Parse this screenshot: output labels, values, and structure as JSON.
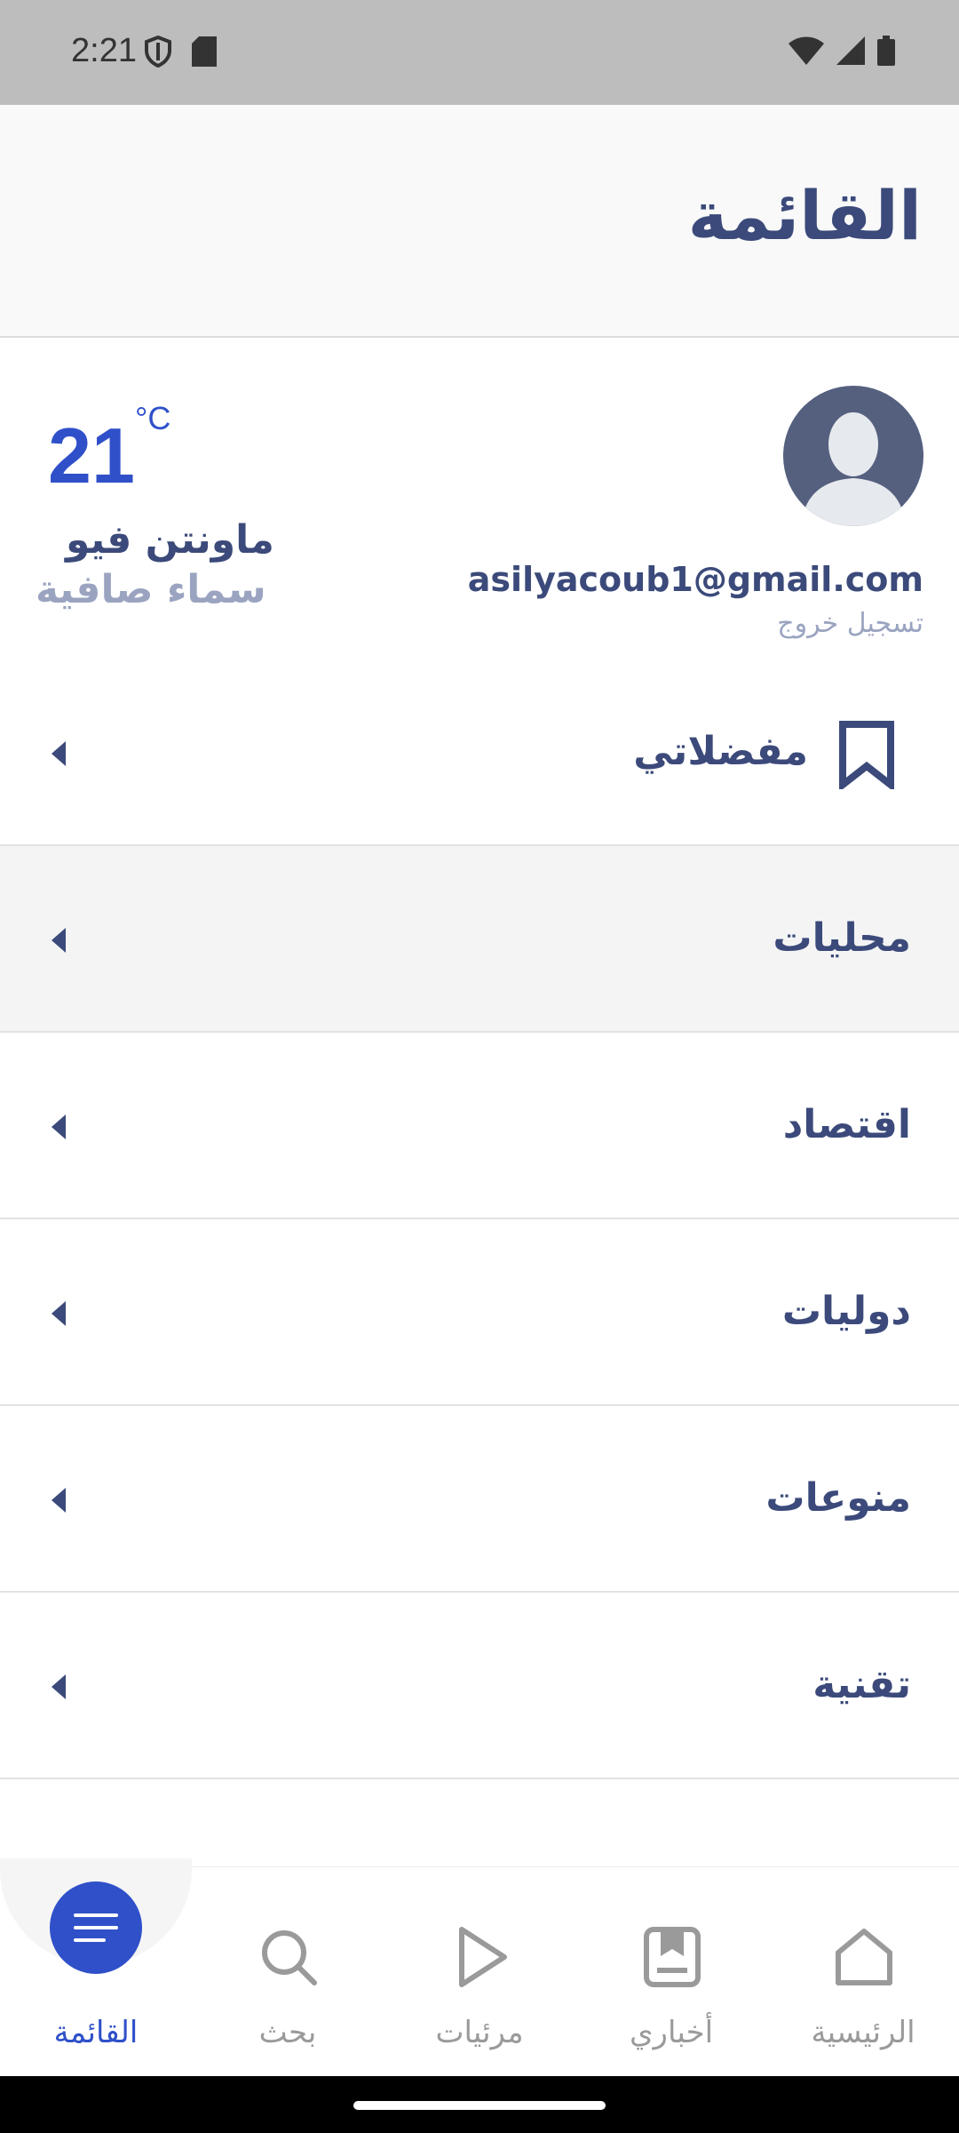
{
  "status_bar": {
    "time": "2:21"
  },
  "header": {
    "title": "القائمة"
  },
  "profile": {
    "email": "asilyacoub1@gmail.com",
    "logout_label": "تسجيل خروج"
  },
  "weather": {
    "temperature": "21",
    "unit": "°C",
    "location": "ماونتن فيو",
    "condition": "سماء صافية"
  },
  "menu": {
    "items": [
      {
        "label": "مفضلاتي"
      },
      {
        "label": "محليات"
      },
      {
        "label": "اقتصاد"
      },
      {
        "label": "دوليات"
      },
      {
        "label": "منوعات"
      },
      {
        "label": "تقنية"
      }
    ]
  },
  "bottom_nav": {
    "items": [
      {
        "label": "القائمة"
      },
      {
        "label": "بحث"
      },
      {
        "label": "مرئيات"
      },
      {
        "label": "أخباري"
      },
      {
        "label": "الرئيسية"
      }
    ]
  },
  "colors": {
    "accent": "#2f50c9",
    "text_primary": "#3b4a7a",
    "text_muted": "#9aa4c0"
  }
}
